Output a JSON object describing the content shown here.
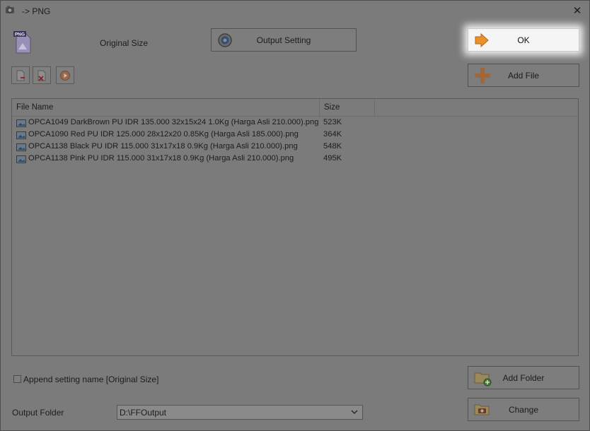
{
  "window": {
    "title": "-> PNG",
    "close_glyph": "✕"
  },
  "header": {
    "format_icon": "png-file-icon",
    "format_badge": "PNG",
    "original_size_label": "Original Size",
    "output_setting_label": "Output Setting",
    "ok_label": "OK",
    "add_file_label": "Add File"
  },
  "toolbar": {
    "icons": [
      "remove-file-icon",
      "clear-list-icon",
      "play-icon"
    ]
  },
  "file_list": {
    "columns": [
      "File Name",
      "Size"
    ],
    "rows": [
      {
        "name": "OPCA1049 DarkBrown PU IDR 135.000 32x15x24 1.0Kg (Harga Asli 210.000).png",
        "size": "523K"
      },
      {
        "name": "OPCA1090 Red PU IDR 125.000 28x12x20 0.85Kg (Harga Asli 185.000).png",
        "size": "364K"
      },
      {
        "name": "OPCA1138 Black PU IDR 115.000 31x17x18 0.9Kg (Harga Asli 210.000).png",
        "size": "548K"
      },
      {
        "name": "OPCA1138 Pink PU IDR 115.000 31x17x18 0.9Kg (Harga Asli 210.000).png",
        "size": "495K"
      }
    ]
  },
  "footer": {
    "append_label": "Append setting name [Original Size]",
    "append_checked": false,
    "output_folder_label": "Output Folder",
    "output_folder_value": "D:\\FFOutput",
    "add_folder_label": "Add Folder",
    "change_label": "Change"
  },
  "colors": {
    "ok_arrow": "#e8922a",
    "plus": "#d8862a",
    "background_dim": "#7b7b7b"
  }
}
